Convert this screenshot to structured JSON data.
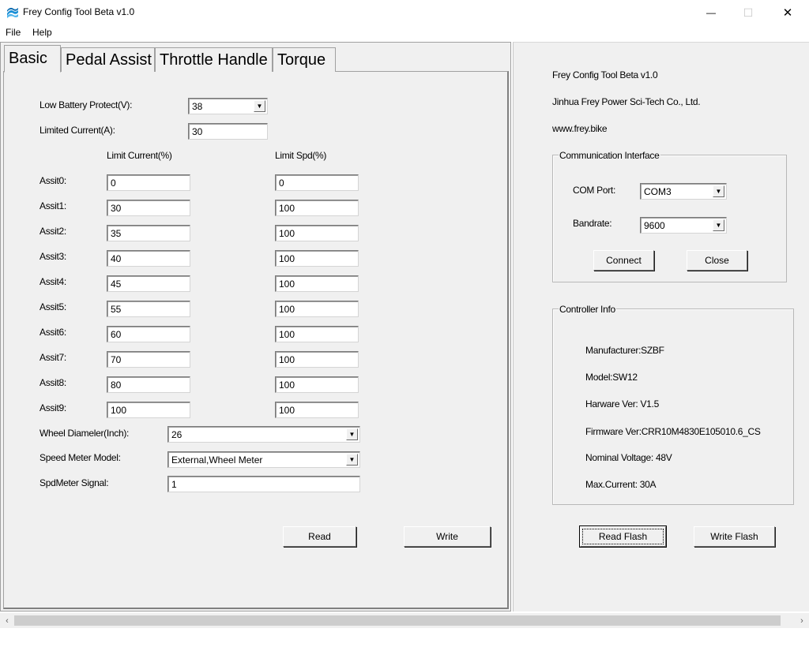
{
  "window": {
    "title": "Frey Config Tool Beta v1.0",
    "minimize_glyph": "—",
    "maximize_glyph": "☐",
    "close_glyph": "✕"
  },
  "menu": {
    "file": "File",
    "help": "Help"
  },
  "tabs": [
    {
      "label": "Basic",
      "active": true
    },
    {
      "label": "Pedal Assist",
      "active": false
    },
    {
      "label": "Throttle Handle",
      "active": false
    },
    {
      "label": "Torque",
      "active": false
    }
  ],
  "basic": {
    "low_battery_label": "Low Battery Protect(V):",
    "low_battery_value": "38",
    "limited_current_label": "Limited Current(A):",
    "limited_current_value": "30",
    "col_limit_current": "Limit Current(%)",
    "col_limit_spd": "Limit Spd(%)",
    "assist_rows": [
      {
        "label": "Assit0:",
        "current": "0",
        "spd": "0"
      },
      {
        "label": "Assit1:",
        "current": "30",
        "spd": "100"
      },
      {
        "label": "Assit2:",
        "current": "35",
        "spd": "100"
      },
      {
        "label": "Assit3:",
        "current": "40",
        "spd": "100"
      },
      {
        "label": "Assit4:",
        "current": "45",
        "spd": "100"
      },
      {
        "label": "Assit5:",
        "current": "55",
        "spd": "100"
      },
      {
        "label": "Assit6:",
        "current": "60",
        "spd": "100"
      },
      {
        "label": "Assit7:",
        "current": "70",
        "spd": "100"
      },
      {
        "label": "Assit8:",
        "current": "80",
        "spd": "100"
      },
      {
        "label": "Assit9:",
        "current": "100",
        "spd": "100"
      }
    ],
    "wheel_diameter_label": "Wheel Diameler(Inch):",
    "wheel_diameter_value": "26",
    "speed_meter_model_label": "Speed Meter Model:",
    "speed_meter_model_value": "External,Wheel Meter",
    "spdmeter_signal_label": "SpdMeter Signal:",
    "spdmeter_signal_value": "1",
    "read_button": "Read",
    "write_button": "Write"
  },
  "info": {
    "app_name": "Frey Config Tool Beta v1.0",
    "company": "Jinhua Frey Power Sci-Tech Co., Ltd.",
    "website": "www.frey.bike"
  },
  "communication": {
    "group_title": "Communication Interface",
    "com_port_label": "COM Port:",
    "com_port_value": "COM3",
    "bandrate_label": "Bandrate:",
    "bandrate_value": "9600",
    "connect_button": "Connect",
    "close_button": "Close"
  },
  "controller": {
    "group_title": "Controller Info",
    "manufacturer": "Manufacturer:SZBF",
    "model": "Model:SW12",
    "hardware_ver": "Harware Ver: V1.5",
    "firmware_ver": "Firmware Ver:CRR10M4830E105010.6_CS",
    "nominal_voltage": "Nominal Voltage: 48V",
    "max_current": "Max.Current: 30A"
  },
  "flash": {
    "read_flash_button": "Read Flash",
    "write_flash_button": "Write Flash"
  },
  "icons": {
    "app": "wave-logo-icon",
    "dropdown": "▼",
    "scroll_left": "‹",
    "scroll_right": "›"
  }
}
